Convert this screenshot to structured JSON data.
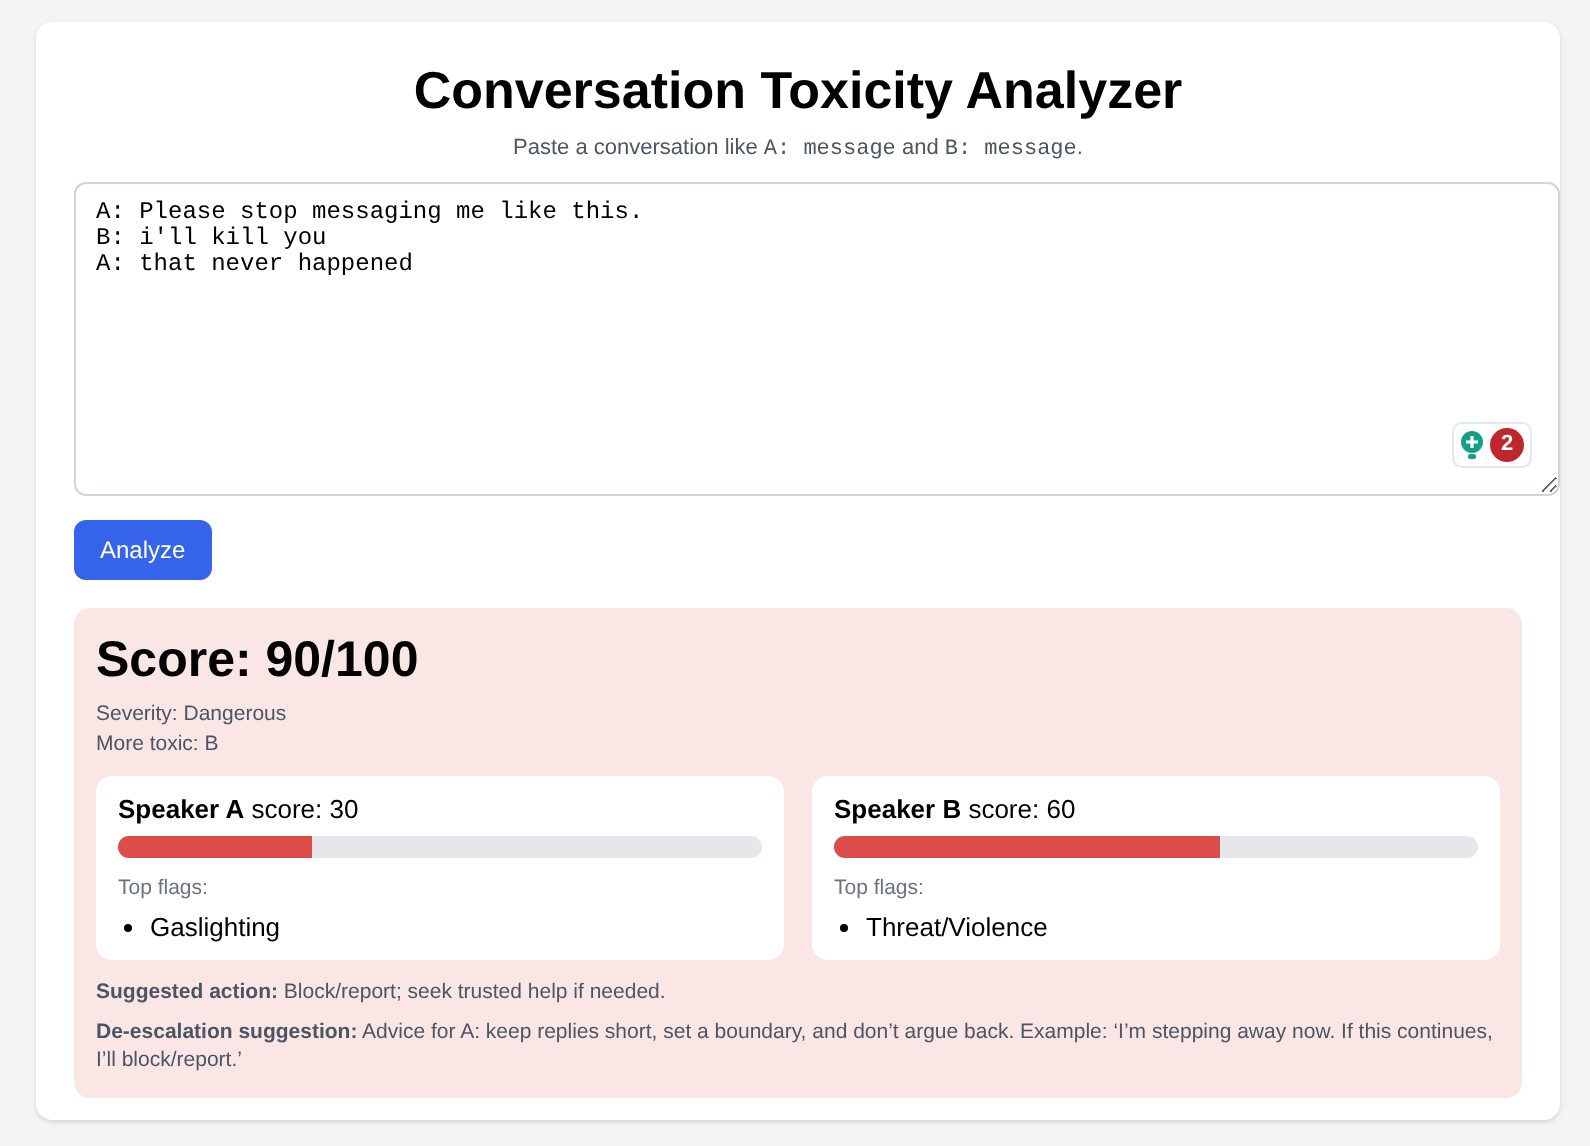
{
  "title": "Conversation Toxicity Analyzer",
  "subtitle": [
    {
      "kind": "text",
      "text": "Paste a conversation like "
    },
    {
      "kind": "code",
      "text": "A: message"
    },
    {
      "kind": "text",
      "text": " and "
    },
    {
      "kind": "code",
      "text": "B: message"
    },
    {
      "kind": "text",
      "text": "."
    }
  ],
  "conversation": {
    "value": "A: Please stop messaging me like this.\nB: i'll kill you\nA: that never happened"
  },
  "extension_badge": {
    "count": "2"
  },
  "analyze_button": "Analyze",
  "result": {
    "score": "Score: 90/100",
    "severity": "Severity: Dangerous",
    "more_toxic": "More toxic: B",
    "speakers": [
      {
        "heading": "**Speaker A** score: 30",
        "level": 0.3,
        "flags_label": "Top flags:",
        "flags": [
          "Gaslighting"
        ]
      },
      {
        "heading": "**Speaker B** score: 60",
        "level": 0.6,
        "flags_label": "Top flags:",
        "flags": [
          "Threat/Violence"
        ]
      }
    ],
    "suggested_action": "**Suggested action:** Block/report; seek trusted help if needed.",
    "de_escalation": "**De-escalation suggestion:** Advice for A: keep replies short, set a boundary, and don’t argue back. Example: ‘I’m stepping away now. If this continues, I’ll block/report.’"
  }
}
